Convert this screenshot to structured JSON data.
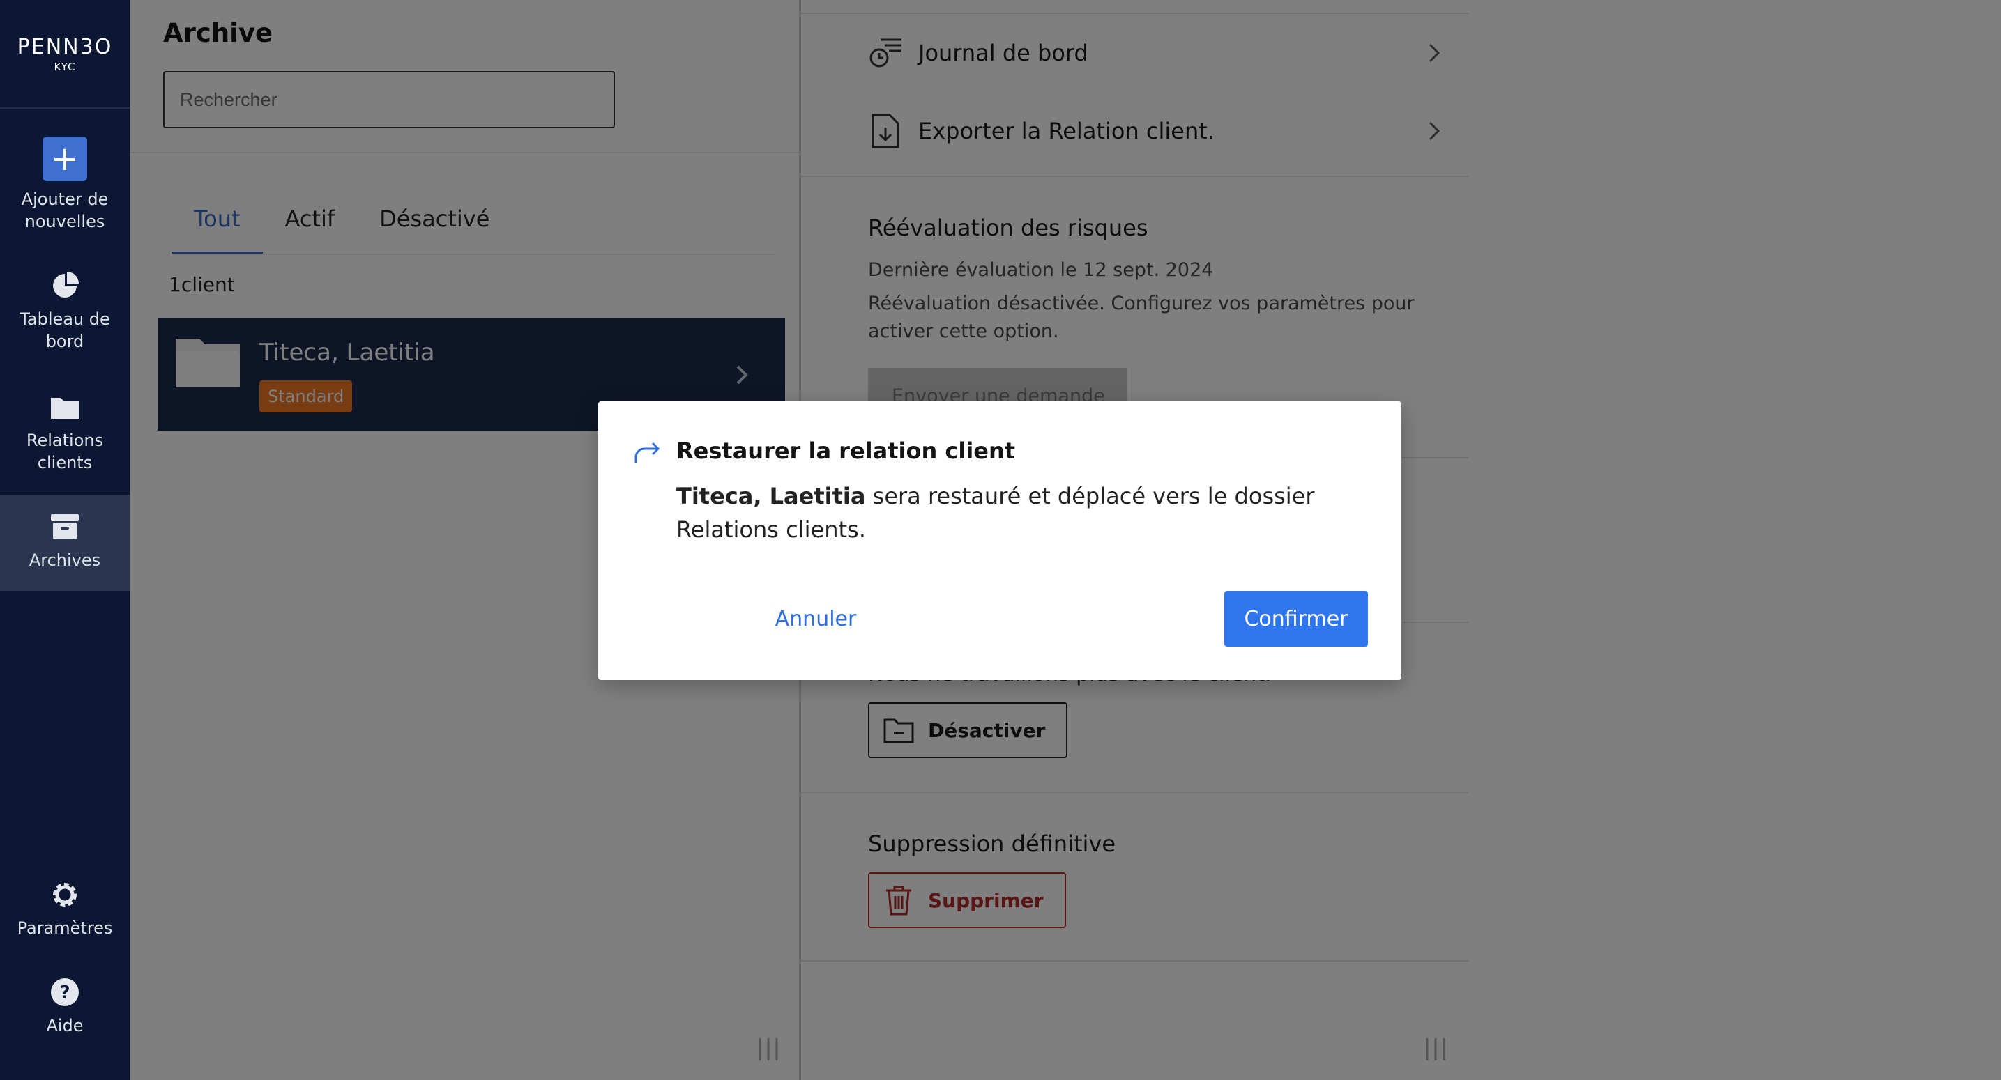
{
  "sidebar": {
    "logo_main": "PENN3O",
    "logo_sub": "KYC",
    "items": [
      {
        "label_line1": "Ajouter de",
        "label_line2": "nouvelles",
        "icon": "plus-icon"
      },
      {
        "label_line1": "Tableau de",
        "label_line2": "bord",
        "icon": "pie-chart-icon"
      },
      {
        "label_line1": "Relations",
        "label_line2": "clients",
        "icon": "folder-icon"
      },
      {
        "label_line1": "Archives",
        "label_line2": "",
        "icon": "archive-box-icon"
      },
      {
        "label_line1": "Paramètres",
        "label_line2": "",
        "icon": "gear-icon"
      },
      {
        "label_line1": "Aide",
        "label_line2": "",
        "icon": "help-icon"
      }
    ]
  },
  "archive": {
    "title": "Archive",
    "search_placeholder": "Rechercher",
    "tabs": [
      "Tout",
      "Actif",
      "Désactivé"
    ],
    "active_tab": "Tout",
    "count_label": "1client",
    "client": {
      "name": "Titeca, Laetitia",
      "badge": "Standard"
    }
  },
  "detail": {
    "rows": [
      {
        "label": "Journal de bord",
        "icon": "log-clock-icon"
      },
      {
        "label": "Exporter la Relation client.",
        "icon": "file-download-icon"
      }
    ],
    "risk": {
      "heading": "Réévaluation des risques",
      "last_eval": "Dernière évaluation le 12 sept. 2024",
      "note": "Réévaluation désactivée. Configurez vos paramètres pour activer cette option.",
      "button": "Envoyer une demande"
    },
    "deactivate": {
      "note": "Nous ne travaillons plus avec le client.",
      "button": "Désactiver"
    },
    "delete": {
      "heading": "Suppression définitive",
      "button": "Supprimer"
    }
  },
  "modal": {
    "title": "Restaurer la relation client",
    "client_name": "Titeca, Laetitia",
    "message": " sera restauré et déplacé vers le dossier Relations clients.",
    "cancel_label": "Annuler",
    "confirm_label": "Confirmer"
  },
  "colors": {
    "sidebar_bg": "#0b1733",
    "accent": "#2f76ee",
    "badge": "#f07a26",
    "danger": "#b52a2a"
  }
}
